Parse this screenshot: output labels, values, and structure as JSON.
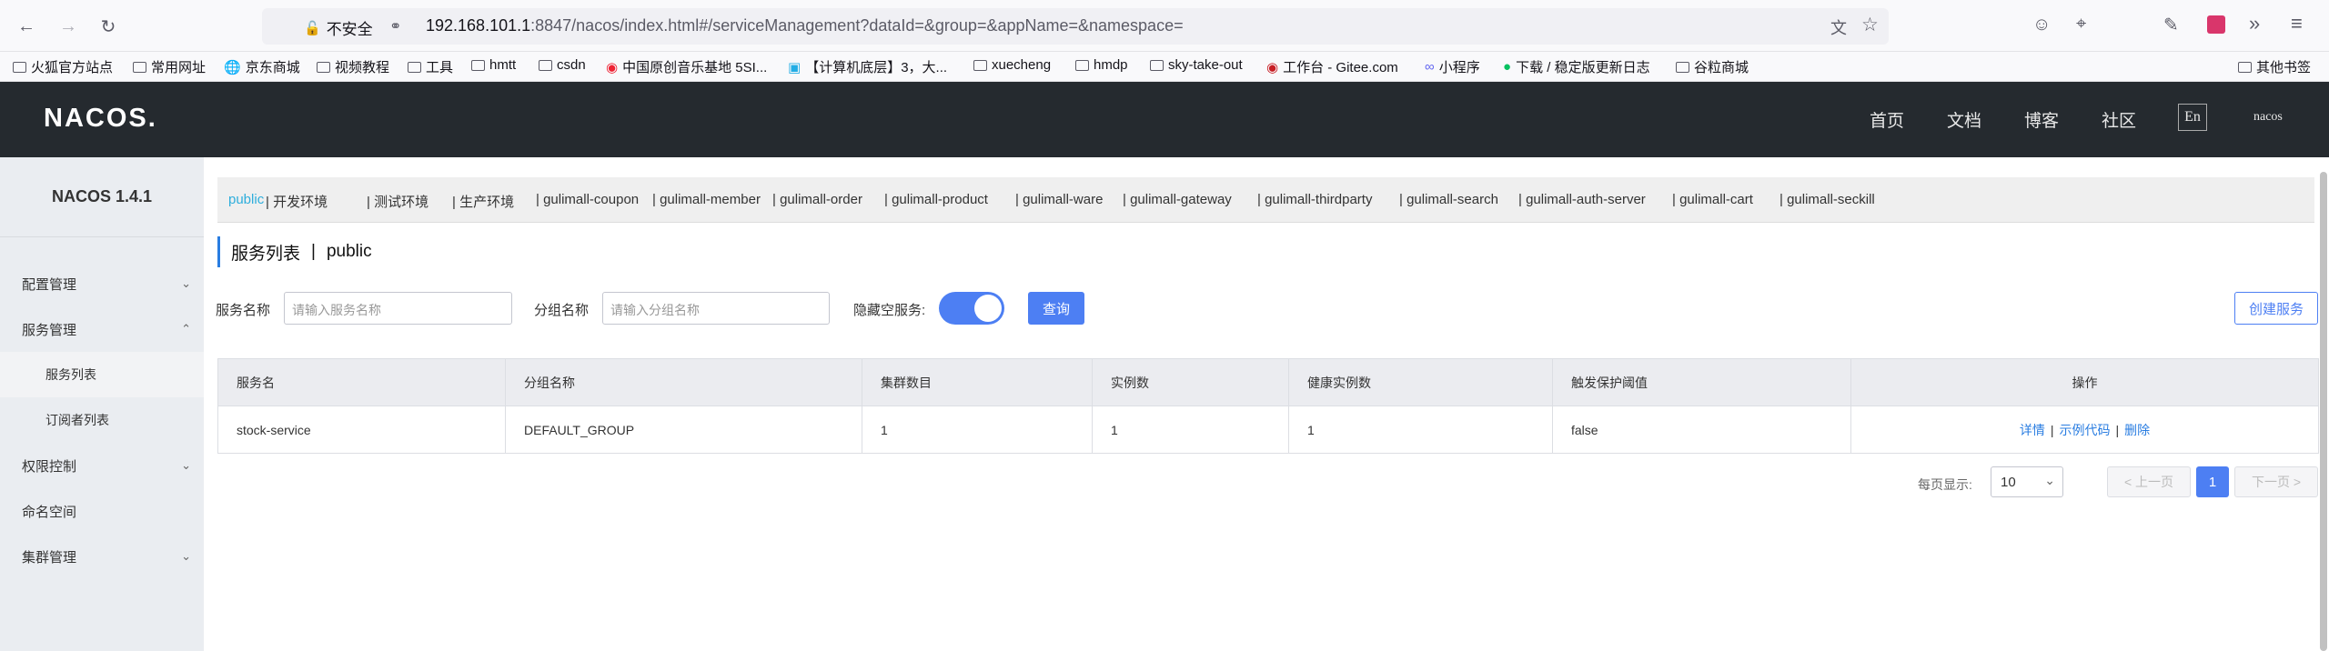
{
  "browser": {
    "back_icon": "arrow-left",
    "insecure_label": "不安全",
    "url_host": "192.168.101.1",
    "url_rest": ":8847/nacos/index.html#/serviceManagement?dataId=&group=&appName=&namespace="
  },
  "bookmarks": [
    {
      "label": "火狐官方站点"
    },
    {
      "label": "常用网址"
    },
    {
      "label": "京东商城"
    },
    {
      "label": "视频教程"
    },
    {
      "label": "工具"
    },
    {
      "label": "hmtt"
    },
    {
      "label": "csdn"
    },
    {
      "label": "中国原创音乐基地 5SI..."
    },
    {
      "label": "【计算机底层】3，大..."
    },
    {
      "label": "xuecheng"
    },
    {
      "label": "hmdp"
    },
    {
      "label": "sky-take-out"
    },
    {
      "label": "工作台 - Gitee.com"
    },
    {
      "label": "小程序"
    },
    {
      "label": "下载 / 稳定版更新日志"
    },
    {
      "label": "谷粒商城"
    },
    {
      "label": "其他书签"
    }
  ],
  "header": {
    "logo": "NACOS.",
    "nav": [
      "首页",
      "文档",
      "博客",
      "社区"
    ],
    "lang": "En",
    "user": "nacos"
  },
  "sidebar": {
    "title": "NACOS 1.4.1",
    "items": [
      {
        "label": "配置管理"
      },
      {
        "label": "服务管理"
      },
      {
        "label": "服务列表"
      },
      {
        "label": "订阅者列表"
      },
      {
        "label": "权限控制"
      },
      {
        "label": "命名空间"
      },
      {
        "label": "集群管理"
      }
    ]
  },
  "namespaces": [
    "public",
    "开发环境",
    "测试环境",
    "生产环境",
    "gulimall-coupon",
    "gulimall-member",
    "gulimall-order",
    "gulimall-product",
    "gulimall-ware",
    "gulimall-gateway",
    "gulimall-thirdparty",
    "gulimall-search",
    "gulimall-auth-server",
    "gulimall-cart",
    "gulimall-seckill"
  ],
  "page": {
    "title": "服务列表",
    "separator": "|",
    "namespace": "public"
  },
  "filters": {
    "service_name_label": "服务名称",
    "service_name_placeholder": "请输入服务名称",
    "group_name_label": "分组名称",
    "group_name_placeholder": "请输入分组名称",
    "hide_empty_label": "隐藏空服务:",
    "hide_empty_on": true,
    "query_label": "查询",
    "create_label": "创建服务"
  },
  "table": {
    "headers": [
      "服务名",
      "分组名称",
      "集群数目",
      "实例数",
      "健康实例数",
      "触发保护阈值",
      "操作"
    ],
    "rows": [
      {
        "service": "stock-service",
        "group": "DEFAULT_GROUP",
        "clusters": "1",
        "instances": "1",
        "healthy": "1",
        "threshold": "false"
      }
    ],
    "actions": [
      "详情",
      "示例代码",
      "删除"
    ]
  },
  "pagination": {
    "page_size_label": "每页显示:",
    "page_size": "10",
    "prev_label": "< 上一页",
    "current": "1",
    "next_label": "下一页 >"
  },
  "colors": {
    "accent": "#4d7ff3",
    "header_bg": "#252a2f",
    "sidebar_bg": "#eaedf1",
    "active_ns": "#2eaedc"
  }
}
